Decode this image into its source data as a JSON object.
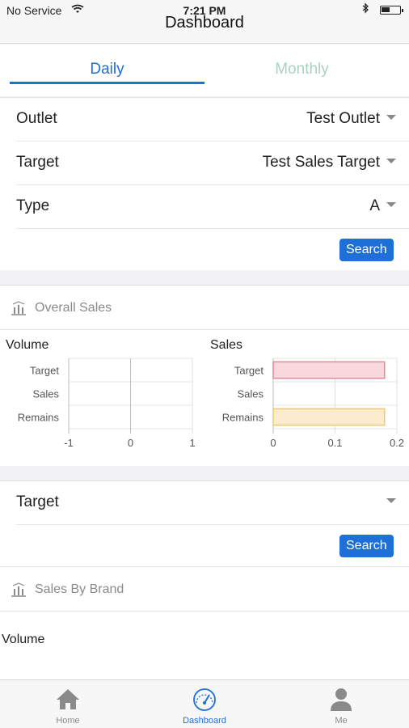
{
  "status_bar": {
    "carrier": "No Service",
    "time": "7:21 PM"
  },
  "nav": {
    "title": "Dashboard"
  },
  "tabs": [
    {
      "label": "Daily",
      "active": true
    },
    {
      "label": "Monthly",
      "active": false
    }
  ],
  "filters": {
    "outlet": {
      "label": "Outlet",
      "value": "Test Outlet"
    },
    "target": {
      "label": "Target",
      "value": "Test Sales Target"
    },
    "type": {
      "label": "Type",
      "value": "A"
    },
    "search_label": "Search"
  },
  "overall_sales": {
    "title": "Overall Sales"
  },
  "chart_data": [
    {
      "type": "bar",
      "orientation": "horizontal",
      "title": "Volume",
      "categories": [
        "Target",
        "Sales",
        "Remains"
      ],
      "values": [
        0,
        0,
        0
      ],
      "xlim": [
        -1,
        1
      ],
      "x_ticks": [
        "-1",
        "0",
        "1"
      ],
      "grid": true
    },
    {
      "type": "bar",
      "orientation": "horizontal",
      "title": "Sales",
      "categories": [
        "Target",
        "Sales",
        "Remains"
      ],
      "values": [
        0.18,
        0,
        0.18
      ],
      "xlim": [
        0,
        0.2
      ],
      "x_ticks": [
        "0",
        "0.1",
        "0.2"
      ],
      "grid": true,
      "bar_colors": [
        "#f8d7dd",
        "#f8d7dd",
        "#fbeccd"
      ],
      "bar_borders": [
        "#e38a98",
        "#e38a98",
        "#f0c87a"
      ]
    }
  ],
  "brand_filters": {
    "target_label": "Target",
    "target_value": "",
    "search_label": "Search"
  },
  "sales_by_brand": {
    "title": "Sales By Brand",
    "volume_label": "Volume"
  },
  "tabbar": [
    {
      "label": "Home",
      "icon": "home-icon",
      "selected": false
    },
    {
      "label": "Dashboard",
      "icon": "dashboard-icon",
      "selected": true
    },
    {
      "label": "Me",
      "icon": "person-icon",
      "selected": false
    }
  ],
  "colors": {
    "accent": "#1f6fd8",
    "inactive_tab": "#a9d3bd"
  }
}
